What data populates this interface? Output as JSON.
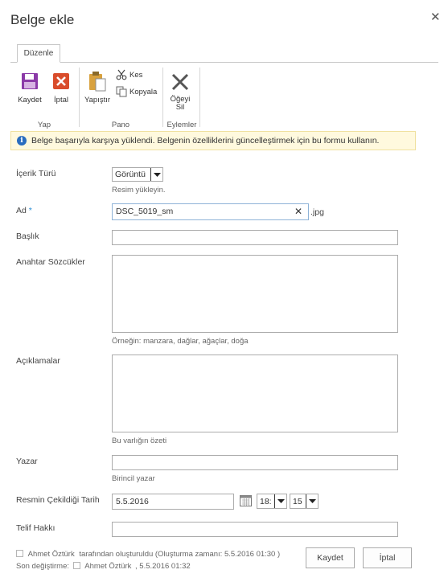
{
  "dialog": {
    "title": "Belge ekle"
  },
  "ribbon": {
    "tab_label": "Düzenle",
    "save_label": "Kaydet",
    "cancel_label": "İptal",
    "group_yap": "Yap",
    "paste_label": "Yapıştır",
    "cut_label": "Kes",
    "copy_label": "Kopyala",
    "group_pano": "Pano",
    "delete_label_line1": "Öğeyi",
    "delete_label_line2": "Sil",
    "group_eylemler": "Eylemler"
  },
  "status": {
    "message": "Belge başarıyla karşıya yüklendi. Belgenin özelliklerini güncelleştirmek için bu formu kullanın."
  },
  "form": {
    "content_type": {
      "label": "İçerik Türü",
      "value": "Görüntü",
      "hint": "Resim yükleyin."
    },
    "name": {
      "label": "Ad",
      "required_mark": "*",
      "value": "DSC_5019_sm",
      "extension": ".jpg"
    },
    "title": {
      "label": "Başlık",
      "value": ""
    },
    "keywords": {
      "label": "Anahtar Sözcükler",
      "hint": "Örneğin: manzara, dağlar, ağaçlar, doğa"
    },
    "description": {
      "label": "Açıklamalar",
      "hint": "Bu varlığın özeti"
    },
    "author": {
      "label": "Yazar",
      "value": "",
      "hint": "Birincil yazar"
    },
    "date_taken": {
      "label": "Resmin Çekildiği Tarih",
      "date": "5.5.2016",
      "hour": "18:",
      "minute": "15"
    },
    "copyright": {
      "label": "Telif Hakkı",
      "value": ""
    }
  },
  "footer": {
    "created_user": "Ahmet Öztürk",
    "created_text": "tarafından oluşturuldu (Oluşturma zamanı: 5.5.2016 01:30 )",
    "modified_prefix": "Son değiştirme:",
    "modified_user": "Ahmet Öztürk",
    "modified_time": ", 5.5.2016 01:32",
    "save_label": "Kaydet",
    "cancel_label": "İptal"
  }
}
